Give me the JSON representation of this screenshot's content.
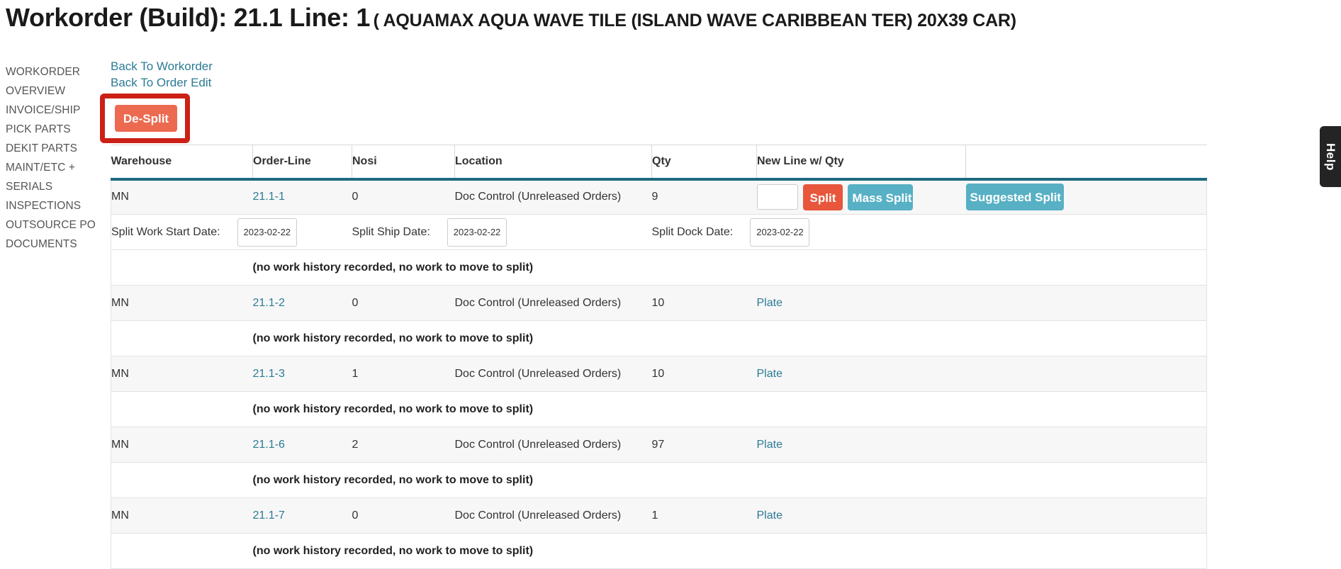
{
  "page": {
    "title_main": "Workorder (Build): 21.1 Line: 1",
    "title_sub": "( AQUAMAX AQUA WAVE TILE (ISLAND WAVE CARIBBEAN TER) 20X39 CAR)"
  },
  "sidebar": {
    "items": [
      {
        "label": "WORKORDER"
      },
      {
        "label": "OVERVIEW"
      },
      {
        "label": "INVOICE/SHIP"
      },
      {
        "label": "PICK PARTS"
      },
      {
        "label": "DEKIT PARTS"
      },
      {
        "label": "MAINT/ETC +"
      },
      {
        "label": "SERIALS"
      },
      {
        "label": "INSPECTIONS"
      },
      {
        "label": "OUTSOURCE PO"
      },
      {
        "label": "DOCUMENTS"
      }
    ]
  },
  "backlinks": [
    {
      "label": "Back To Workorder"
    },
    {
      "label": "Back To Order Edit"
    }
  ],
  "actions": {
    "desplit_label": "De-Split",
    "split_label": "Split",
    "mass_split_label": "Mass Split",
    "suggested_split_label": "Suggested Split",
    "new_qty_value": ""
  },
  "table": {
    "headers": [
      "Warehouse",
      "Order-Line",
      "Nosi",
      "Location",
      "Qty",
      "New Line w/ Qty",
      ""
    ],
    "note_text": "(no work history recorded, no work to move to split)",
    "rows": [
      {
        "warehouse": "MN",
        "order_line": "21.1-1",
        "nosi": "0",
        "location": "Doc Control (Unreleased Orders)",
        "qty": "9",
        "new_line": "",
        "has_split_controls": true
      },
      {
        "warehouse": "MN",
        "order_line": "21.1-2",
        "nosi": "0",
        "location": "Doc Control (Unreleased Orders)",
        "qty": "10",
        "new_line": "Plate",
        "has_split_controls": false
      },
      {
        "warehouse": "MN",
        "order_line": "21.1-3",
        "nosi": "1",
        "location": "Doc Control (Unreleased Orders)",
        "qty": "10",
        "new_line": "Plate",
        "has_split_controls": false
      },
      {
        "warehouse": "MN",
        "order_line": "21.1-6",
        "nosi": "2",
        "location": "Doc Control (Unreleased Orders)",
        "qty": "97",
        "new_line": "Plate",
        "has_split_controls": false
      },
      {
        "warehouse": "MN",
        "order_line": "21.1-7",
        "nosi": "0",
        "location": "Doc Control (Unreleased Orders)",
        "qty": "1",
        "new_line": "Plate",
        "has_split_controls": false
      }
    ]
  },
  "dates": {
    "work_start_label": "Split Work Start Date:",
    "work_start_value": "2023-02-22",
    "ship_label": "Split Ship Date:",
    "ship_value": "2023-02-22",
    "dock_label": "Split Dock Date:",
    "dock_value": "2023-02-22"
  },
  "help": {
    "label": "Help"
  },
  "colors": {
    "link": "#2b7b94",
    "orange": "#e8563b",
    "teal": "#57b0c4",
    "header_underline": "#1e6a80",
    "annotation": "#cc2016",
    "help_tab": "#242424"
  }
}
